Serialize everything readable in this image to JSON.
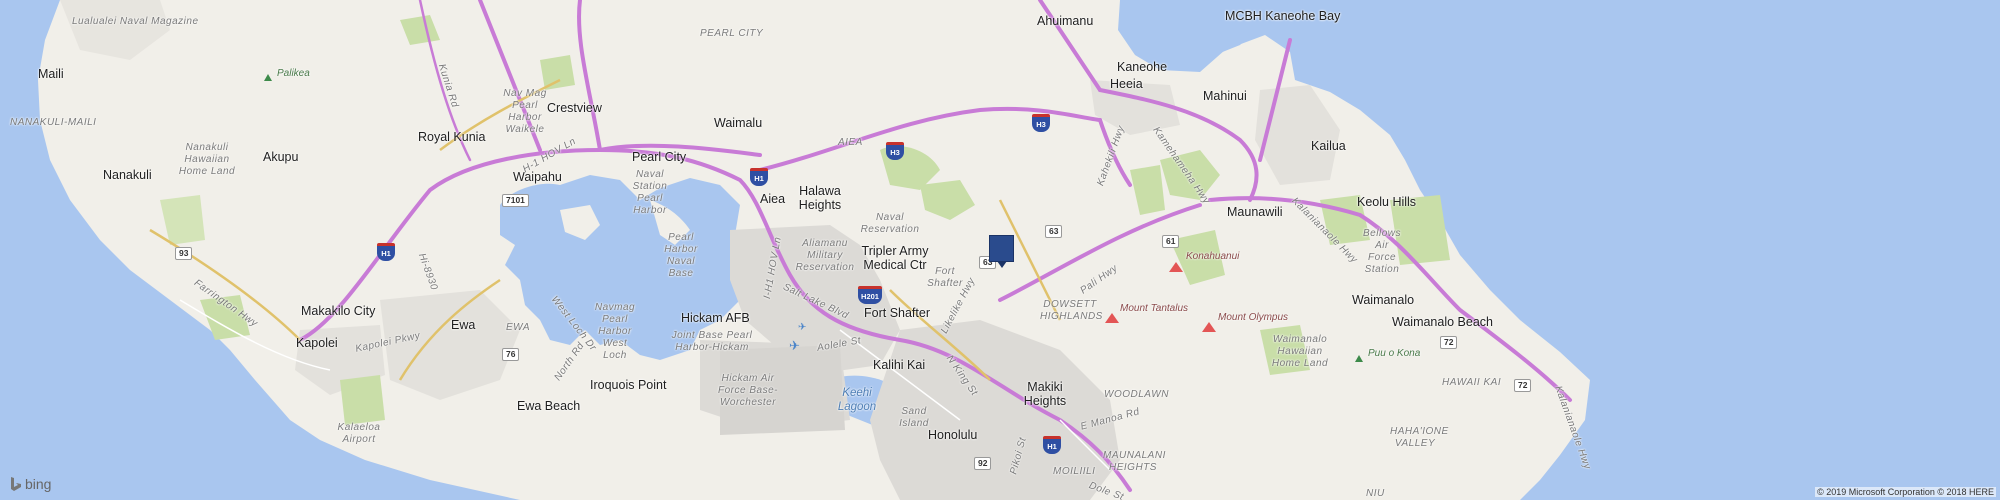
{
  "map": {
    "provider": "bing",
    "copyright": "© 2019 Microsoft Corporation © 2018 HERE",
    "colors": {
      "water": "#a9c6ef",
      "land": "#f1efe9",
      "park": "#c9dea8",
      "urban": "#dcdad6",
      "highway": "#c87bd6",
      "marker": "#2a4b8d"
    },
    "places": [
      {
        "name": "Lualualei Naval Magazine",
        "kind": "area"
      },
      {
        "name": "Maili",
        "kind": "town"
      },
      {
        "name": "NANAKULI-MAILI",
        "kind": "area"
      },
      {
        "name": "Nanakuli",
        "kind": "town"
      },
      {
        "name": "Nanakuli Hawaiian Home Land",
        "kind": "area"
      },
      {
        "name": "Akupu",
        "kind": "town"
      },
      {
        "name": "Palikea",
        "kind": "peak"
      },
      {
        "name": "Royal Kunia",
        "kind": "town"
      },
      {
        "name": "Kunia Rd",
        "kind": "road"
      },
      {
        "name": "Nav Mag Pearl Harbor Waikele",
        "kind": "area"
      },
      {
        "name": "Crestview",
        "kind": "town"
      },
      {
        "name": "Waipahu",
        "kind": "town"
      },
      {
        "name": "Pearl City",
        "kind": "town"
      },
      {
        "name": "PEARL CITY",
        "kind": "area"
      },
      {
        "name": "Waimalu",
        "kind": "town"
      },
      {
        "name": "AIEA",
        "kind": "area"
      },
      {
        "name": "Aiea",
        "kind": "town"
      },
      {
        "name": "Halawa Heights",
        "kind": "town"
      },
      {
        "name": "Naval Station Pearl Harbor",
        "kind": "area"
      },
      {
        "name": "Naval Reservation",
        "kind": "area"
      },
      {
        "name": "Tripler Army Medical Ctr",
        "kind": "town"
      },
      {
        "name": "Aliamanu Military Reservation",
        "kind": "area"
      },
      {
        "name": "Fort Shafter",
        "kind": "area"
      },
      {
        "name": "Fort Shafter",
        "kind": "town"
      },
      {
        "name": "Ahuimanu",
        "kind": "town"
      },
      {
        "name": "Kaneohe",
        "kind": "town"
      },
      {
        "name": "Heeia",
        "kind": "town"
      },
      {
        "name": "Mahinui",
        "kind": "town"
      },
      {
        "name": "MCBH Kaneohe Bay",
        "kind": "town"
      },
      {
        "name": "Kailua",
        "kind": "town"
      },
      {
        "name": "Maunawili",
        "kind": "town"
      },
      {
        "name": "Keolu Hills",
        "kind": "town"
      },
      {
        "name": "Bellows Air Force Station",
        "kind": "area"
      },
      {
        "name": "Waimanalo",
        "kind": "town"
      },
      {
        "name": "Waimanalo Beach",
        "kind": "town"
      },
      {
        "name": "Waimanalo Hawaiian Home Land",
        "kind": "area"
      },
      {
        "name": "Puu o Kona",
        "kind": "park"
      },
      {
        "name": "HAWAII KAI",
        "kind": "area"
      },
      {
        "name": "HAHA'IONE VALLEY",
        "kind": "area"
      },
      {
        "name": "NIU",
        "kind": "area"
      },
      {
        "name": "Konahuanui",
        "kind": "peak"
      },
      {
        "name": "Mount Tantalus",
        "kind": "peak"
      },
      {
        "name": "Mount Olympus",
        "kind": "peak"
      },
      {
        "name": "DOWSETT HIGHLANDS",
        "kind": "area"
      },
      {
        "name": "WOODLAWN",
        "kind": "area"
      },
      {
        "name": "MAUNALANI HEIGHTS",
        "kind": "area"
      },
      {
        "name": "Makiki Heights",
        "kind": "town"
      },
      {
        "name": "Honolulu",
        "kind": "town"
      },
      {
        "name": "MOILIILI",
        "kind": "area"
      },
      {
        "name": "Kalihi Kai",
        "kind": "town"
      },
      {
        "name": "Sand Island",
        "kind": "area"
      },
      {
        "name": "Keehi Lagoon",
        "kind": "water"
      },
      {
        "name": "Hickam AFB",
        "kind": "town"
      },
      {
        "name": "Joint Base Pearl Harbor-Hickam",
        "kind": "area"
      },
      {
        "name": "Hickam Air Force Base-Worchester",
        "kind": "area"
      },
      {
        "name": "Pearl Harbor Naval Base",
        "kind": "area"
      },
      {
        "name": "Navmag Pearl Harbor West Loch",
        "kind": "area"
      },
      {
        "name": "Iroquois Point",
        "kind": "town"
      },
      {
        "name": "Ewa",
        "kind": "town"
      },
      {
        "name": "EWA",
        "kind": "area"
      },
      {
        "name": "Ewa Beach",
        "kind": "town"
      },
      {
        "name": "Makakilo City",
        "kind": "town"
      },
      {
        "name": "Kapolei",
        "kind": "town"
      },
      {
        "name": "Kalaeloa Airport",
        "kind": "area"
      },
      {
        "name": "Farrington Hwy",
        "kind": "road"
      },
      {
        "name": "Kapolei Pkwy",
        "kind": "road"
      },
      {
        "name": "West Loch Dr",
        "kind": "road"
      },
      {
        "name": "North Rd",
        "kind": "road"
      },
      {
        "name": "Hi-8930",
        "kind": "road"
      },
      {
        "name": "H-1 HOV Ln",
        "kind": "road"
      },
      {
        "name": "I-H1 HOV Ln",
        "kind": "road"
      },
      {
        "name": "Salt Lake Blvd",
        "kind": "road"
      },
      {
        "name": "Aolele St",
        "kind": "road"
      },
      {
        "name": "Likelike Hwy",
        "kind": "road"
      },
      {
        "name": "N King St",
        "kind": "road"
      },
      {
        "name": "Pali Hwy",
        "kind": "road"
      },
      {
        "name": "E Manoa Rd",
        "kind": "road"
      },
      {
        "name": "Pikoi St",
        "kind": "road"
      },
      {
        "name": "Kahekili Hwy",
        "kind": "road"
      },
      {
        "name": "Kamehameha Hwy",
        "kind": "road"
      },
      {
        "name": "Kalanianaole Hwy",
        "kind": "road"
      },
      {
        "name": "Kalanianaole Hwy",
        "kind": "road"
      },
      {
        "name": "Dole St",
        "kind": "road"
      }
    ],
    "shields": [
      "H1",
      "H1",
      "H1",
      "H3",
      "H3",
      "H201",
      "63",
      "63",
      "61",
      "72",
      "72",
      "93",
      "76",
      "7101",
      "92"
    ],
    "marker": {
      "name": "property-marker"
    }
  }
}
